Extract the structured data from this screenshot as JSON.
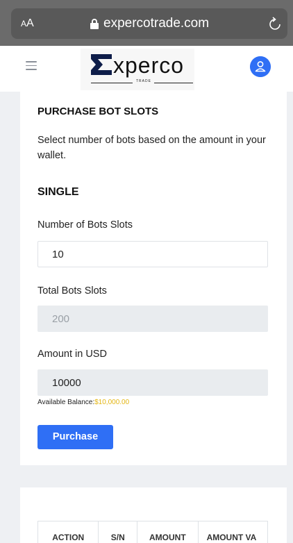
{
  "browser": {
    "aa_label": "AA",
    "url": "expercotrade.com"
  },
  "header": {
    "logo_text": "xperco",
    "logo_subtext": "TRADE"
  },
  "purchase": {
    "title": "PURCHASE BOT SLOTS",
    "description": "Select number of bots based on the amount in your wallet.",
    "section": "SINGLE",
    "bots_label": "Number of Bots Slots",
    "bots_value": "10",
    "total_label": "Total Bots Slots",
    "total_value": "200",
    "amount_label": "Amount in USD",
    "amount_value": "10000",
    "balance_label": "Available Balance:",
    "balance_value": "$10,000.00",
    "button": "Purchase"
  },
  "table": {
    "headers": [
      "ACTION",
      "S/N",
      "AMOUNT",
      "AMOUNT VA"
    ]
  },
  "colors": {
    "accent": "#2f6ff5",
    "balance": "#e3b512",
    "browser_bar": "#6b6b6b"
  }
}
